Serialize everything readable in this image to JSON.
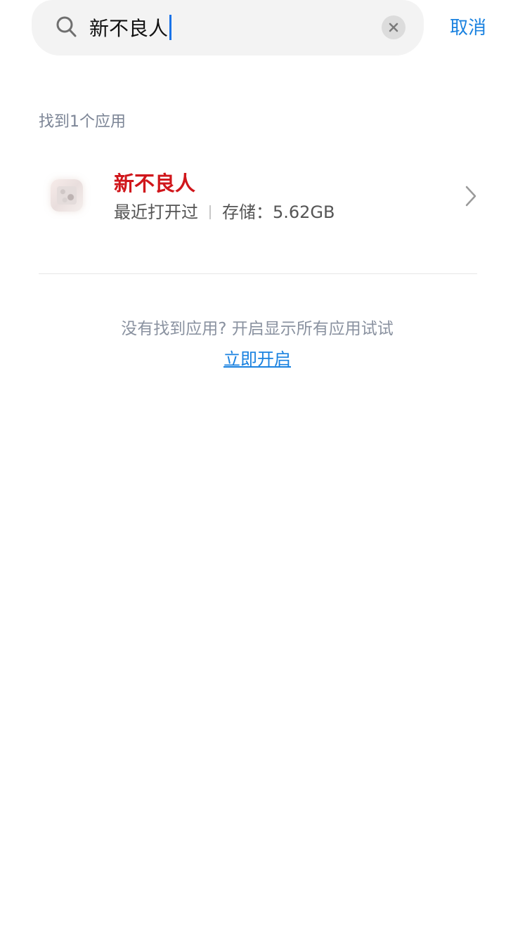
{
  "search": {
    "query": "新不良人",
    "cancel_label": "取消"
  },
  "results": {
    "count_label": "找到1个应用",
    "apps": [
      {
        "name": "新不良人",
        "status": "最近打开过",
        "storage": "存储：5.62GB"
      }
    ]
  },
  "hint": {
    "text": "没有找到应用? 开启显示所有应用试试",
    "link_label": "立即开启"
  },
  "colors": {
    "accent": "#1a82e0",
    "app_name": "#d0161b",
    "caret": "#1a73e8"
  }
}
